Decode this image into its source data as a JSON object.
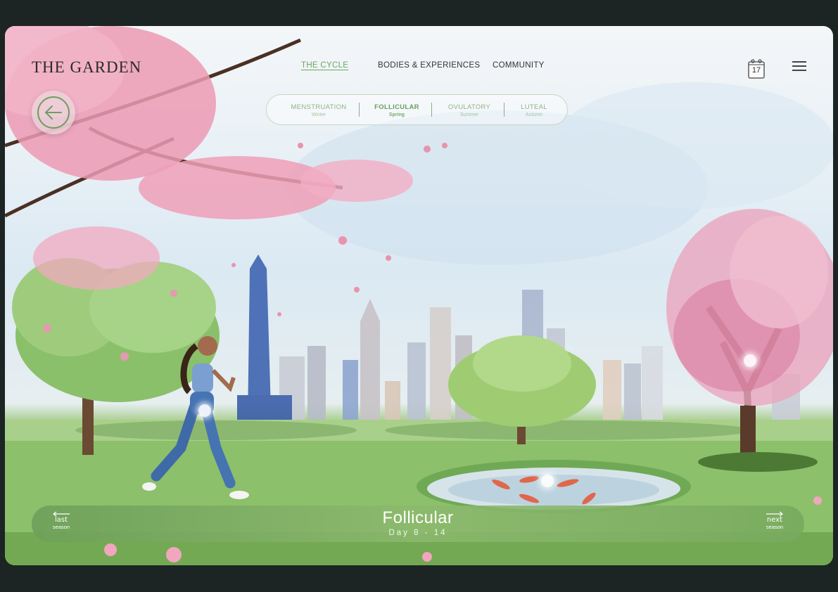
{
  "header": {
    "logo": "THE GARDEN",
    "nav": [
      {
        "label": "THE CYCLE"
      },
      {
        "label": "BODIES & EXPERIENCES"
      },
      {
        "label": "COMMUNITY"
      }
    ],
    "calendar_day": "17",
    "icons": {
      "calendar": "calendar-icon",
      "menu": "hamburger-menu-icon",
      "back": "arrow-left-icon"
    }
  },
  "phases": [
    {
      "name": "MENSTRUATION",
      "season": "Winter"
    },
    {
      "name": "FOLLICULAR",
      "season": "Spring"
    },
    {
      "name": "OVULATORY",
      "season": "Summer"
    },
    {
      "name": "LUTEAL",
      "season": "Autumn"
    }
  ],
  "active_phase": "FOLLICULAR",
  "bottom": {
    "title": "Follicular",
    "subtitle": "Day 8 - 14",
    "last_label_1": "last",
    "last_label_2": "season",
    "next_label_1": "next",
    "next_label_2": "season"
  },
  "colors": {
    "accent_green": "#6aa860",
    "bar_green": "#7fb060",
    "blossom_pink": "#e88aa5",
    "background": "#1c2424"
  }
}
